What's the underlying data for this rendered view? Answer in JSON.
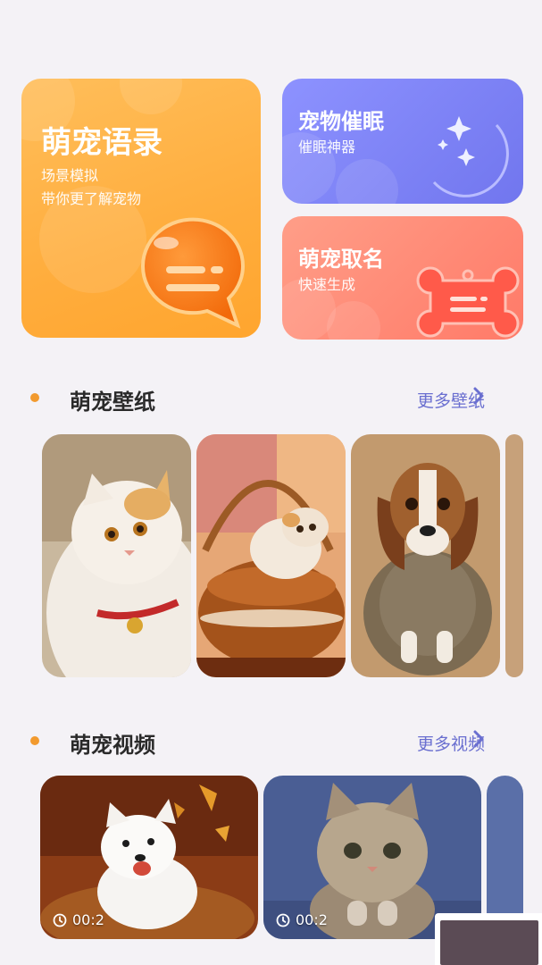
{
  "cards": {
    "quotes": {
      "title": "萌宠语录",
      "sub1": "场景模拟",
      "sub2": "带你更了解宠物"
    },
    "hypno": {
      "title": "宠物催眠",
      "sub": "催眠神器"
    },
    "name": {
      "title": "萌宠取名",
      "sub": "快速生成"
    }
  },
  "wallpapers": {
    "title": "萌宠壁纸",
    "more": "更多壁纸",
    "items": [
      "cat-gazing",
      "cat-in-basket",
      "beagle-in-jacket",
      "partial-photo"
    ]
  },
  "videos": {
    "title": "萌宠视频",
    "more": "更多视频",
    "items": [
      {
        "time": "00:2",
        "subject": "westie-puppy-autumn"
      },
      {
        "time": "00:2",
        "subject": "tabby-kitten"
      }
    ]
  },
  "colors": {
    "accent": "#6a6fd0",
    "dot": "#f29a2e",
    "orange": "#ffad3d",
    "purple": "#7f84f7",
    "coral": "#ff8a74"
  }
}
